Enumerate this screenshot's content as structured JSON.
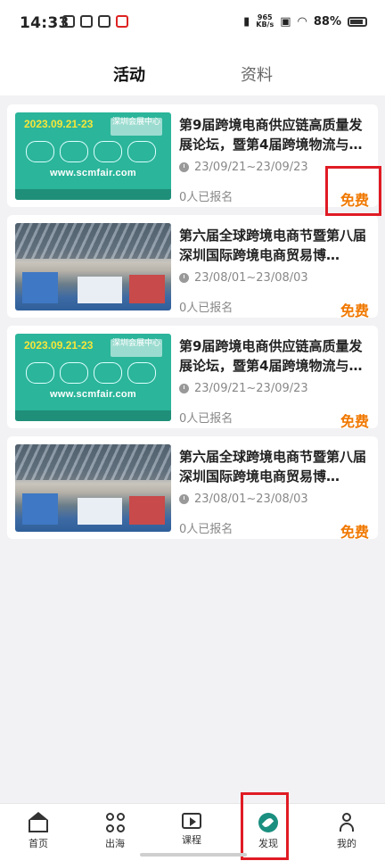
{
  "status_bar": {
    "time": "14:33",
    "net_speed_value": "965",
    "net_speed_unit": "KB/s",
    "battery": "88%"
  },
  "tabs": [
    {
      "label": "活动",
      "active": true
    },
    {
      "label": "资料",
      "active": false
    }
  ],
  "events": [
    {
      "title": "第9届跨境电商供应链高质量发展论坛，暨第4届跨境物流与…",
      "date": "23/09/21~23/09/23",
      "signup": "0人已报名",
      "price": "免费",
      "thumb": {
        "kind": "promo",
        "date_text": "2023.09.21-23",
        "venue_text": "深圳会展中心",
        "url_text": "www.scmfair.com"
      }
    },
    {
      "title": "第六届全球跨境电商节暨第八届深圳国际跨境电商贸易博…",
      "date": "23/08/01~23/08/03",
      "signup": "0人已报名",
      "price": "免费",
      "thumb": {
        "kind": "photo"
      }
    },
    {
      "title": "第9届跨境电商供应链高质量发展论坛，暨第4届跨境物流与…",
      "date": "23/09/21~23/09/23",
      "signup": "0人已报名",
      "price": "免费",
      "thumb": {
        "kind": "promo",
        "date_text": "2023.09.21-23",
        "venue_text": "深圳会展中心",
        "url_text": "www.scmfair.com"
      }
    },
    {
      "title": "第六届全球跨境电商节暨第八届深圳国际跨境电商贸易博…",
      "date": "23/08/01~23/08/03",
      "signup": "0人已报名",
      "price": "免费",
      "thumb": {
        "kind": "photo"
      }
    }
  ],
  "bottom_nav": [
    {
      "label": "首页",
      "icon": "home-icon"
    },
    {
      "label": "出海",
      "icon": "grid-icon"
    },
    {
      "label": "课程",
      "icon": "play-icon"
    },
    {
      "label": "发现",
      "icon": "discover-icon",
      "active": true
    },
    {
      "label": "我的",
      "icon": "user-icon"
    }
  ],
  "colors": {
    "accent_price": "#f07800",
    "highlight": "#e01b24",
    "discover": "#1a8f80"
  }
}
